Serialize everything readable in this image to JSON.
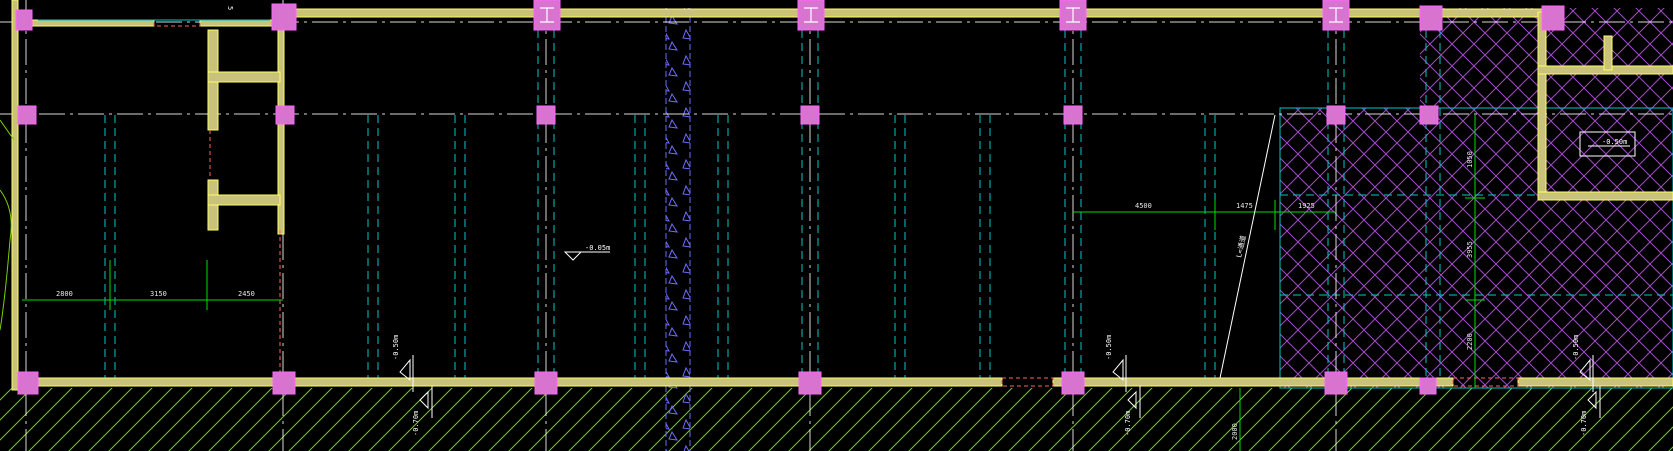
{
  "drawing": {
    "colors": {
      "background": "#000000",
      "wall_fill": "#c8c27a",
      "wall_edge": "#ffff66",
      "column": "#d873d0",
      "column_edge": "#ff66ff",
      "grid_axis": "#ffffff",
      "hidden_line": "#00c8c8",
      "dimension": "#00dd00",
      "hatch": "#a04cc8",
      "ground_hatch": "#7ad000",
      "strip": "#6c6cff"
    },
    "dimensions": {
      "left_1": "2800",
      "left_2": "3150",
      "left_3": "2450",
      "right_1": "4500",
      "right_2": "1475",
      "right_3": "1925",
      "vert_1": "1050",
      "vert_2": "3955",
      "vert_3": "2200",
      "bottom": "2000"
    },
    "levels": {
      "main": "-0.05m",
      "box": "-0.50m",
      "edge_1": "-0.50m",
      "edge_2": "-0.50m",
      "edge_3": "-0.50m",
      "below_1": "-0.70m",
      "below_2": "-0.70m",
      "below_3": "-0.70m"
    },
    "notes": {
      "top_tag": "5",
      "diag_label": "L=通道"
    }
  }
}
